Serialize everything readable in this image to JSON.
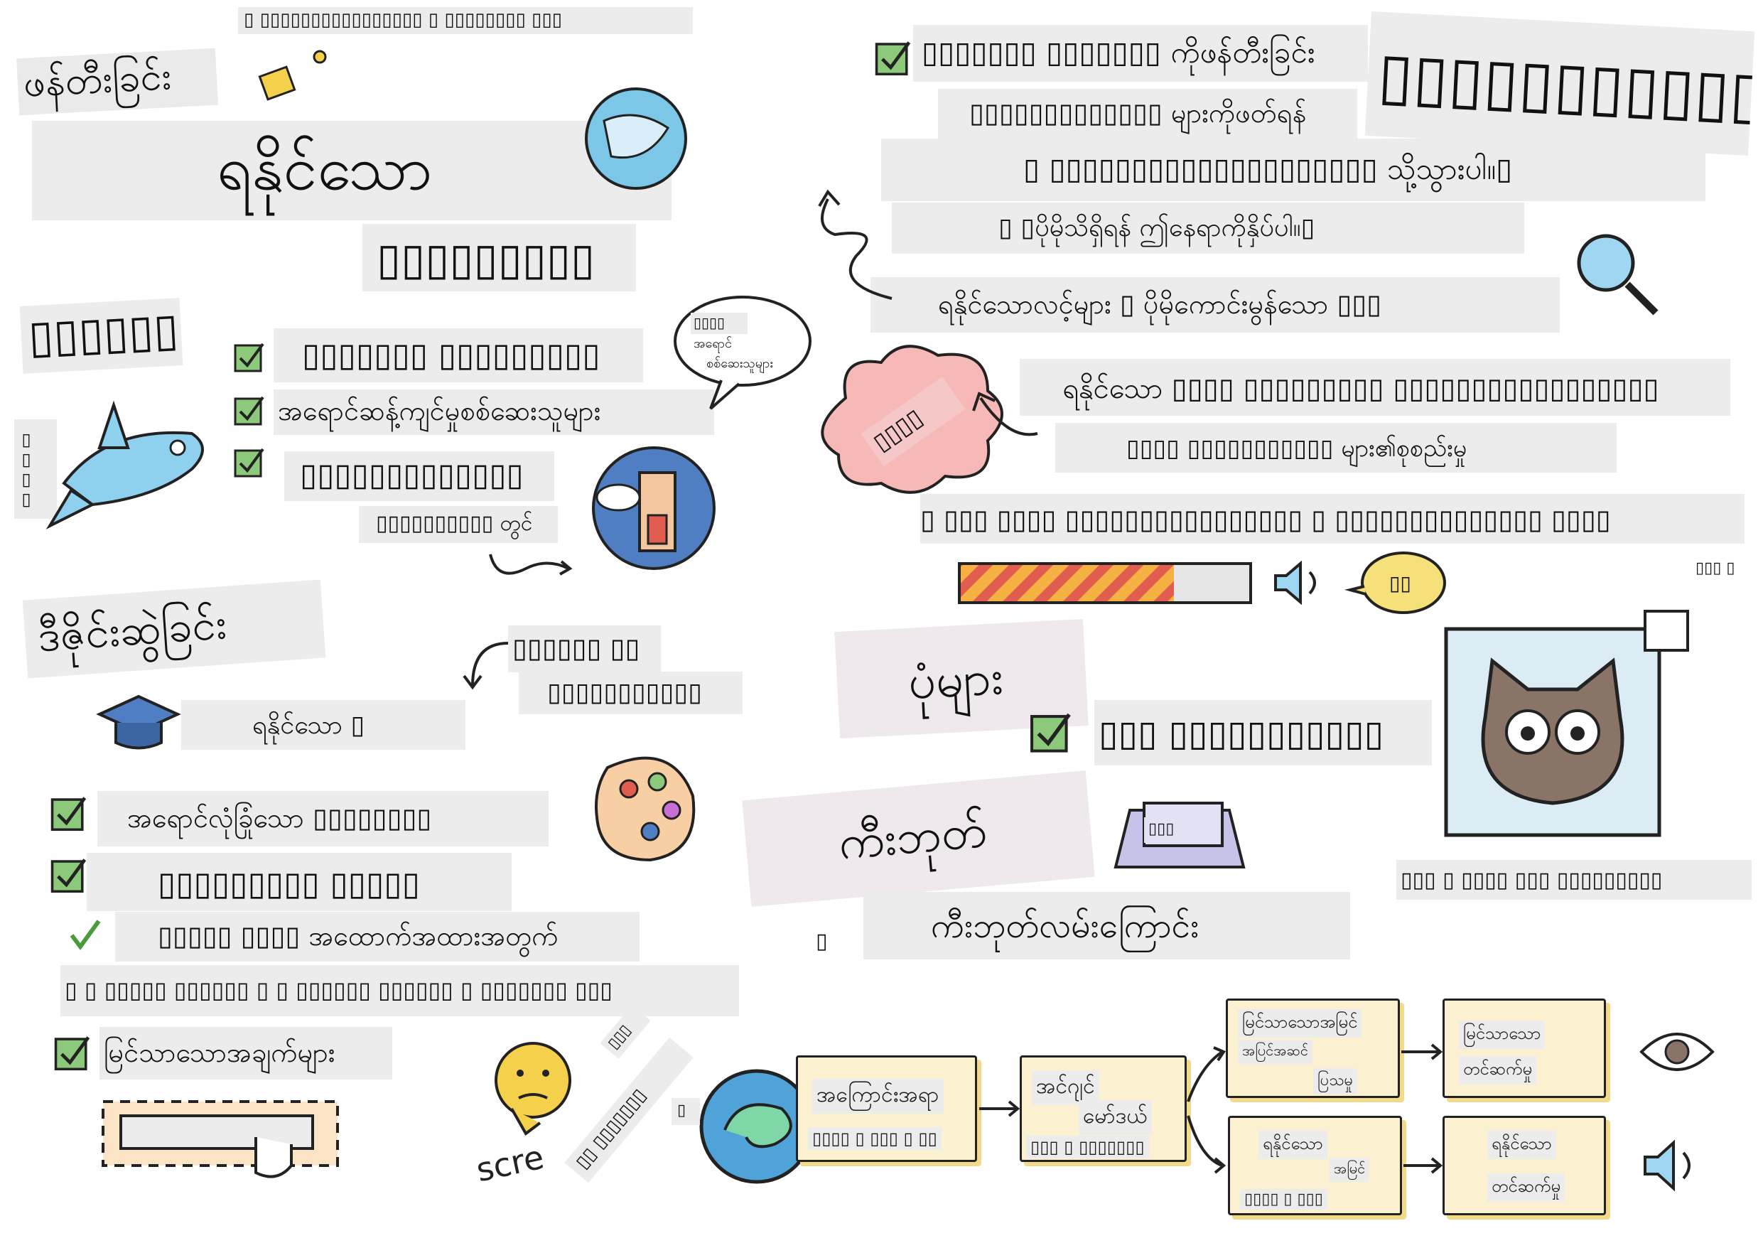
{
  "top": {
    "caption": "▯ ▯▯▯▯▯▯▯▯▯▯▯▯▯▯▯▯ ▯ ▯▯▯▯▯▯▯▯ ▯▯▯"
  },
  "left": {
    "heading_1": "ဖန်တီးခြင်း",
    "heading_2": "ရနိုင်သော",
    "heading_3": "▯▯▯▯▯▯▯▯▯",
    "section_a": {
      "title": "▯▯▯▯▯▯",
      "items": [
        "▯▯▯▯▯▯▯ ▯▯▯▯▯▯▯▯▯",
        "အရောင်ဆန့်ကျင်မှုစစ်ဆေးသူများ",
        "▯▯▯▯▯▯▯▯▯▯▯▯▯"
      ],
      "sub": "▯▯▯▯▯▯▯▯▯▯ တွင်",
      "side_label": "▯▯▯▯",
      "bubble_line1": "▯▯▯▯",
      "bubble_line2": "အရောင်",
      "bubble_line3": "စစ်ဆေးသူများ"
    },
    "section_b": {
      "title": "ဒီဇိုင်းဆွဲခြင်း",
      "note_1": "▯▯▯▯▯▯ ▯▯",
      "note_2": "▯▯▯▯▯▯▯▯▯▯▯",
      "cap_label": "ရနိုင်သော ▯",
      "items": [
        "အရောင်လုံခြုံသော ▯▯▯▯▯▯▯▯",
        "▯▯▯▯▯▯▯▯▯ ▯▯▯▯▯",
        "▯▯▯▯▯ ▯▯▯▯ အထောက်အထားအတွက်"
      ],
      "long_line": "▯ ▯ ▯▯▯▯▯ ▯▯▯▯▯▯ ▯ ▯ ▯▯▯▯▯▯ ▯▯▯▯▯▯ ▯ ▯▯▯▯▯▯▯ ▯▯▯",
      "last_item": "မြင်သာသောအချက်များ",
      "scre_text": "scre",
      "tilted_1": "▯▯ ▯▯▯▯▯▯▯",
      "tilted_2": "▯▯▯"
    }
  },
  "right": {
    "intro_1": "▯▯▯▯▯▯▯ ▯▯▯▯▯▯▯ ကိုဖန်တီးခြင်း",
    "big_title": "▯▯▯▯▯▯▯▯▯▯▯▯▯▯",
    "intro_2": "▯▯▯▯▯▯▯▯▯▯▯▯▯ များကိုဖတ်ရန်",
    "intro_3": "▯ ▯▯▯▯▯▯▯▯▯▯▯▯▯▯▯▯▯▯▯▯ သို့သွားပါ။▯",
    "intro_4": "▯ ▯ပိုမိုသိရှိရန် ဤနေရာကိုနှိပ်ပါ။▯",
    "intro_5": "ရနိုင်သောလင့်များ ▯ ပိုမိုကောင်းမွန်သော ▯▯▯",
    "cloud_label": "▯▯▯▯",
    "cloud_line_1": "ရနိုင်သော ▯▯▯▯ ▯▯▯▯▯▯▯▯▯ ▯▯▯▯▯▯▯▯▯▯▯▯▯▯▯▯▯",
    "cloud_line_2": "▯▯▯▯ ▯▯▯▯▯▯▯▯▯▯▯ များ၏စုစည်းမှု",
    "cloud_line_3": "▯ ▯▯▯ ▯▯▯▯ ▯▯▯▯▯▯▯▯▯▯▯▯▯▯▯▯ ▯ ▯▯▯▯▯▯▯▯▯▯▯▯▯▯ ▯▯▯▯",
    "speech_bubble": "▯▯",
    "corner_small": "▯▯▯ ▯",
    "images": {
      "title": "ပုံများ",
      "item": "▯▯▯ ▯▯▯▯▯▯▯▯▯▯▯",
      "caption": "▯▯▯ ▯ ▯▯▯▯ ▯▯▯ ▯▯▯▯▯▯▯▯▯"
    },
    "keyboard": {
      "title": "ကီးဘုတ်",
      "key_label": "▯▯▯",
      "item_prefix": "▯",
      "item": "ကီးဘုတ်လမ်းကြောင်း"
    }
  },
  "flow": {
    "node_1_a": "အကြောင်းအရာ",
    "node_1_b": "▯▯▯▯ ▯ ▯▯▯ ▯ ▯▯",
    "node_2_a": "အင်ဂျင်",
    "node_2_b": "မော်ဒယ်",
    "node_2_c": "▯▯▯ ▯ ▯▯▯▯▯▯▯",
    "node_3_a": "မြင်သာသောအမြင်",
    "node_3_b": "အပြင်အဆင်",
    "node_3_c": "ပြသမှု",
    "node_4_a": "မြင်သာသော",
    "node_4_b": "တင်ဆက်မှု",
    "node_5_a": "ရနိုင်သော",
    "node_5_b": "အမြင်",
    "node_5_c": "▯▯▯▯ ▯ ▯▯▯",
    "node_6_a": "ရနိုင်သော",
    "node_6_b": "တင်ဆက်မှု",
    "edge_label": "▯"
  },
  "colors": {
    "check_green": "#8cc97a",
    "label_bg": "#ececec",
    "node_fill": "#fbf1d0",
    "accent_blue": "#4fa3d8",
    "accent_yellow": "#f5d04a",
    "cloud_pink": "#f7b8b8"
  }
}
